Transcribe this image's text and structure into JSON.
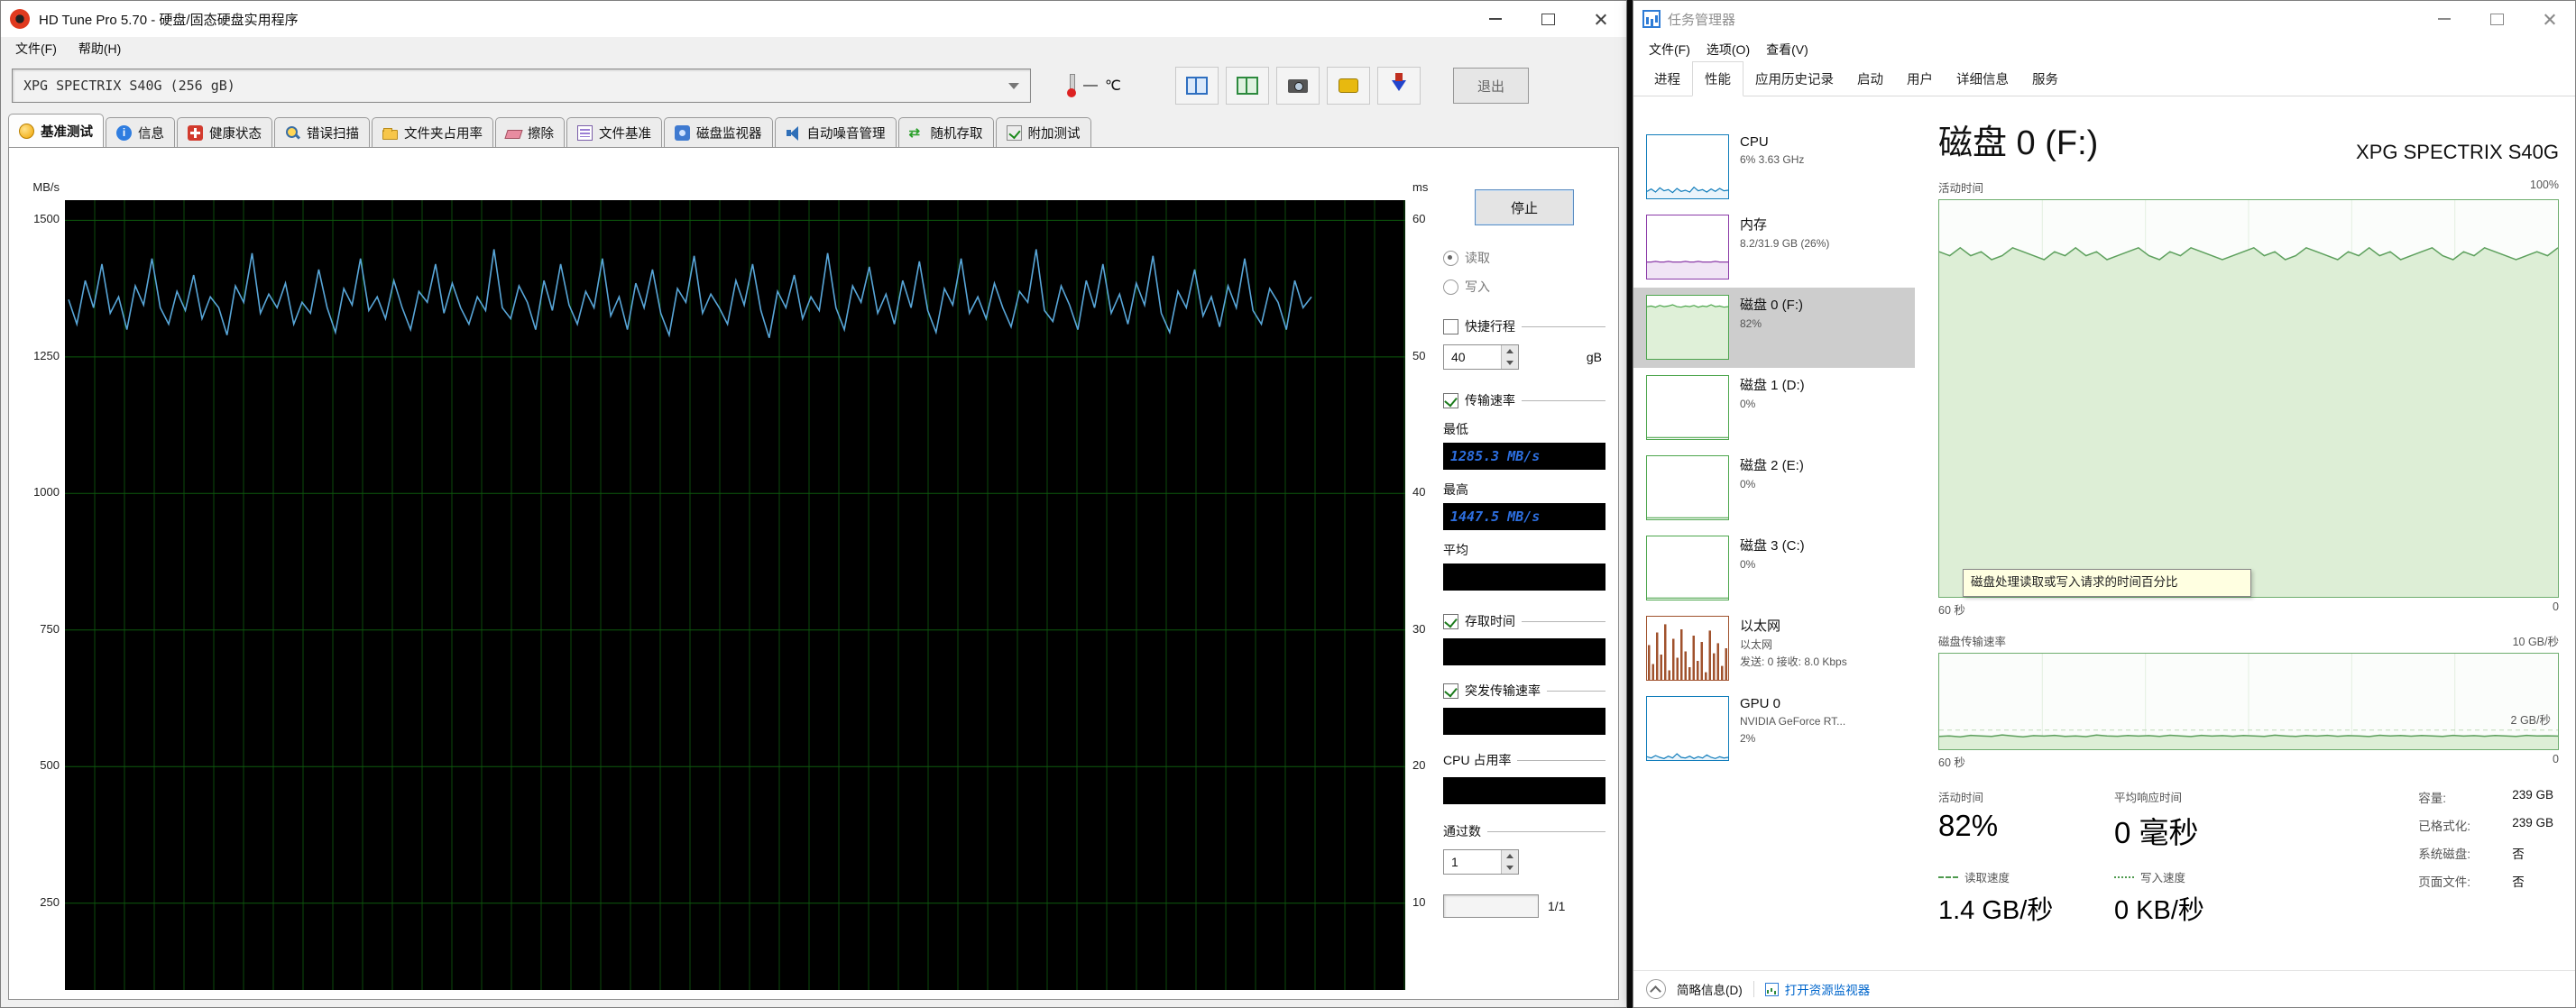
{
  "hdtune": {
    "title": "HD Tune Pro 5.70 - 硬盘/固态硬盘实用程序",
    "menu": {
      "file": "文件(F)",
      "help": "帮助(H)"
    },
    "toolbar": {
      "drive": "XPG SPECTRIX S40G (256 gB)",
      "temp_dash": "—",
      "temp_unit": "℃",
      "exit": "退出"
    },
    "tabs": [
      {
        "label": "基准测试"
      },
      {
        "label": "信息"
      },
      {
        "label": "健康状态"
      },
      {
        "label": "错误扫描"
      },
      {
        "label": "文件夹占用率"
      },
      {
        "label": "擦除"
      },
      {
        "label": "文件基准"
      },
      {
        "label": "磁盘监视器"
      },
      {
        "label": "自动噪音管理"
      },
      {
        "label": "随机存取"
      },
      {
        "label": "附加测试"
      }
    ],
    "controls": {
      "stop": "停止",
      "read": "读取",
      "write": "写入",
      "short_stroke": "快捷行程",
      "short_stroke_value": "40",
      "gb_unit": "gB",
      "transfer_rate": "传输速率",
      "min_label": "最低",
      "min_value": "1285.3 MB/s",
      "max_label": "最高",
      "max_value": "1447.5 MB/s",
      "avg_label": "平均",
      "access_time": "存取时间",
      "burst_rate": "突发传输速率",
      "cpu_usage": "CPU 占用率",
      "pass_label": "通过数",
      "pass_value": "1",
      "progress": "1/1"
    },
    "chart_data": {
      "type": "line",
      "y_left_label": "MB/s",
      "y_right_label": "ms",
      "ticks_left": [
        1500,
        1250,
        1000,
        750,
        500,
        250
      ],
      "ticks_right": [
        60,
        50,
        40,
        30,
        20,
        10
      ],
      "vmax": 1537,
      "vrange": 1446,
      "x_end_frac": 0.93,
      "line_color": "#58a6d8",
      "series": [
        {
          "name": "读取传输速率",
          "values": [
            1355,
            1310,
            1390,
            1340,
            1420,
            1330,
            1360,
            1300,
            1380,
            1345,
            1430,
            1340,
            1310,
            1370,
            1335,
            1400,
            1320,
            1360,
            1340,
            1290,
            1380,
            1350,
            1440,
            1330,
            1365,
            1340,
            1385,
            1310,
            1350,
            1330,
            1410,
            1340,
            1295,
            1375,
            1345,
            1430,
            1335,
            1360,
            1320,
            1390,
            1340,
            1300,
            1370,
            1350,
            1420,
            1330,
            1385,
            1340,
            1310,
            1360,
            1335,
            1447,
            1340,
            1320,
            1380,
            1350,
            1300,
            1390,
            1335,
            1420,
            1345,
            1310,
            1370,
            1340,
            1430,
            1325,
            1360,
            1300,
            1385,
            1340,
            1410,
            1330,
            1290,
            1375,
            1350,
            1435,
            1330,
            1365,
            1340,
            1310,
            1390,
            1345,
            1420,
            1335,
            1285,
            1370,
            1340,
            1400,
            1320,
            1360,
            1335,
            1440,
            1340,
            1300,
            1380,
            1350,
            1415,
            1330,
            1365,
            1310,
            1390,
            1340,
            1425,
            1335,
            1295,
            1375,
            1345,
            1430,
            1330,
            1360,
            1320,
            1385,
            1340,
            1305,
            1370,
            1350,
            1447,
            1335,
            1315,
            1380,
            1345,
            1300,
            1390,
            1340,
            1420,
            1330,
            1365,
            1310,
            1385,
            1345,
            1435,
            1330,
            1295,
            1370,
            1340,
            1410,
            1325,
            1360,
            1305,
            1380,
            1340,
            1430,
            1335,
            1310,
            1375,
            1350,
            1300,
            1390,
            1340,
            1360
          ]
        }
      ]
    }
  },
  "taskmgr": {
    "title": "任务管理器",
    "menu": [
      "文件(F)",
      "选项(O)",
      "查看(V)"
    ],
    "tabs": [
      "进程",
      "性能",
      "应用历史记录",
      "启动",
      "用户",
      "详细信息",
      "服务"
    ],
    "sidebar": [
      {
        "name": "CPU",
        "detail": "6% 3.63 GHz"
      },
      {
        "name": "内存",
        "detail": "8.2/31.9 GB (26%)"
      },
      {
        "name": "磁盘 0 (F:)",
        "detail": "82%"
      },
      {
        "name": "磁盘 1 (D:)",
        "detail": "0%"
      },
      {
        "name": "磁盘 2 (E:)",
        "detail": "0%"
      },
      {
        "name": "磁盘 3 (C:)",
        "detail": "0%"
      },
      {
        "name": "以太网",
        "detail": "以太网",
        "detail2": "发送: 0 接收: 8.0 Kbps"
      },
      {
        "name": "GPU 0",
        "detail": "NVIDIA GeForce RT...",
        "detail2": "2%"
      }
    ],
    "main": {
      "title": "磁盘 0 (F:)",
      "subtitle": "XPG SPECTRIX S40G",
      "chart1_label": "活动时间",
      "chart1_max": "100%",
      "chart1_x_left": "60 秒",
      "chart1_x_right": "0",
      "tooltip": "磁盘处理读取或写入请求的时间百分比",
      "chart2_label": "磁盘传输速率",
      "chart2_max": "10 GB/秒",
      "chart2_gridline": "2 GB/秒",
      "chart2_x_left": "60 秒",
      "chart2_x_right": "0",
      "stats": {
        "active_label": "活动时间",
        "active_value": "82%",
        "response_label": "平均响应时间",
        "response_value": "0 毫秒",
        "read_label": "读取速度",
        "read_value": "1.4 GB/秒",
        "write_label": "写入速度",
        "write_value": "0 KB/秒"
      },
      "info": [
        {
          "label": "容量:",
          "value": "239 GB"
        },
        {
          "label": "已格式化:",
          "value": "239 GB"
        },
        {
          "label": "系统磁盘:",
          "value": "否"
        },
        {
          "label": "页面文件:",
          "value": "否"
        }
      ]
    },
    "footer": {
      "less_detail": "简略信息(D)",
      "open_resmon": "打开资源监视器"
    },
    "chart_data": [
      {
        "name": "磁盘活动时间",
        "type": "area",
        "max": 100,
        "vgrid": 6,
        "color": "#5da05d",
        "fill": "#ddeed6",
        "values": [
          87,
          86,
          88,
          86,
          87,
          85,
          86,
          88,
          87,
          86,
          85,
          87,
          86,
          88,
          86,
          87,
          85,
          86,
          87,
          88,
          86,
          85,
          87,
          86,
          88,
          87,
          86,
          85,
          86,
          87,
          88,
          86,
          87,
          85,
          86,
          88,
          87,
          86,
          85,
          87,
          86,
          88,
          86,
          87,
          85,
          86,
          87,
          88,
          86,
          85,
          87,
          86,
          88,
          87,
          86,
          85,
          86,
          87,
          86,
          88
        ]
      },
      {
        "name": "磁盘传输速率",
        "type": "area",
        "max": 10,
        "vgrid": 6,
        "hline_frac": 0.8,
        "color": "#5da05d",
        "fill": "#ddeed6",
        "values": [
          1.35,
          1.4,
          1.3,
          1.45,
          1.4,
          1.35,
          1.5,
          1.4,
          1.3,
          1.42,
          1.38,
          1.45,
          1.35,
          1.4,
          1.32,
          1.48,
          1.4,
          1.36,
          1.44,
          1.38,
          1.42,
          1.35,
          1.46,
          1.4,
          1.33,
          1.45,
          1.38,
          1.42,
          1.36,
          1.44,
          1.4,
          1.35,
          1.47,
          1.4,
          1.34,
          1.43,
          1.38,
          1.45,
          1.36,
          1.42,
          1.4,
          1.33,
          1.46,
          1.39,
          1.43,
          1.37,
          1.44,
          1.4,
          1.35,
          1.45,
          1.38,
          1.42,
          1.36,
          1.43,
          1.4,
          1.34,
          1.45,
          1.39,
          1.41,
          1.38
        ]
      }
    ],
    "spark": {
      "cpu": {
        "type": "line",
        "max": 100,
        "color": "#117dbb",
        "fill": "#eaf4fb",
        "border": "#117dbb",
        "values": [
          10,
          14,
          9,
          16,
          11,
          13,
          8,
          15,
          10,
          12,
          9,
          17,
          11,
          13,
          9,
          14,
          10,
          15,
          11,
          12
        ]
      },
      "mem": {
        "type": "line",
        "max": 100,
        "color": "#8b3ba8",
        "fill": "#f0e4f5",
        "border": "#8b3ba8",
        "values": [
          26,
          26,
          27,
          26,
          26,
          27,
          26,
          26,
          26,
          27,
          26,
          26,
          27,
          26,
          26,
          26,
          27,
          26,
          26,
          26
        ]
      },
      "disk0": {
        "type": "line",
        "max": 100,
        "color": "#4da64d",
        "fill": "#dff0d8",
        "border": "#4da64d",
        "values": [
          85,
          86,
          84,
          87,
          85,
          86,
          88,
          85,
          84,
          86,
          85,
          87,
          84,
          86,
          85,
          88,
          85,
          86,
          84,
          85
        ]
      },
      "disk1": {
        "type": "line",
        "max": 100,
        "color": "#4da64d",
        "fill": "#ffffff",
        "border": "#4da64d",
        "values": [
          1,
          1,
          1,
          1,
          1,
          1,
          1,
          1,
          1,
          1,
          1,
          1,
          1,
          1,
          1,
          1,
          1,
          1,
          1,
          1
        ]
      },
      "disk2": {
        "type": "line",
        "max": 100,
        "color": "#4da64d",
        "fill": "#ffffff",
        "border": "#4da64d",
        "values": [
          1,
          1,
          1,
          1,
          1,
          1,
          1,
          1,
          1,
          1,
          1,
          1,
          1,
          1,
          1,
          1,
          1,
          1,
          1,
          1
        ]
      },
      "disk3": {
        "type": "line",
        "max": 100,
        "color": "#4da64d",
        "fill": "#ffffff",
        "border": "#4da64d",
        "values": [
          1,
          1,
          1,
          1,
          1,
          1,
          1,
          1,
          1,
          1,
          1,
          1,
          1,
          1,
          1,
          1,
          1,
          1,
          1,
          1
        ]
      },
      "eth": {
        "type": "bars",
        "max": 100,
        "color": "#a0522d",
        "border": "#a0522d",
        "values": [
          55,
          25,
          75,
          40,
          88,
          15,
          65,
          35,
          80,
          45,
          20,
          70,
          30,
          60,
          12,
          78,
          42,
          58,
          22,
          50
        ]
      },
      "gpu": {
        "type": "line",
        "max": 100,
        "color": "#117dbb",
        "fill": "#eaf4fb",
        "border": "#117dbb",
        "values": [
          4,
          2,
          6,
          3,
          1,
          5,
          2,
          9,
          3,
          2,
          5,
          1,
          4,
          2,
          7,
          3,
          1,
          4,
          2,
          3
        ]
      }
    }
  }
}
